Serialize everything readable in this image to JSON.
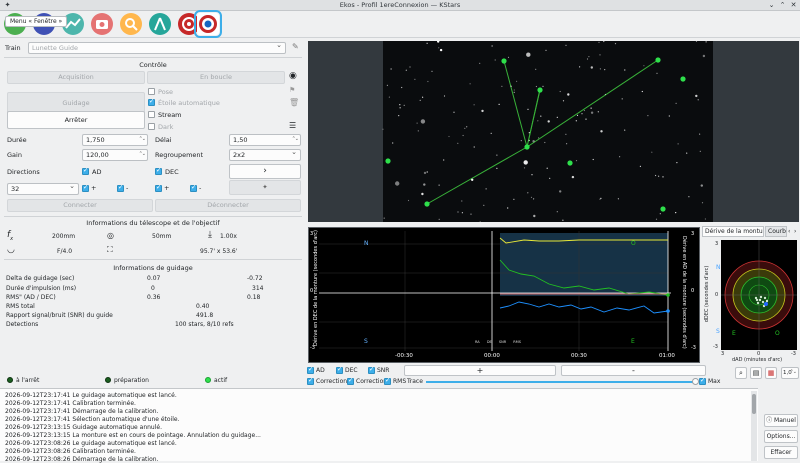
{
  "window": {
    "title": "Ekos - Profil 1ereConnexion — KStars"
  },
  "menu_button": "Menu « Fenêtre »",
  "train": {
    "label": "Train",
    "value": "Lunette Guide"
  },
  "controle": {
    "title": "Contrôle",
    "buttons": {
      "acquisition": "Acquisition",
      "en_boucle": "En boucle",
      "guidage": "Guidage",
      "arreter": "Arrêter",
      "connecter": "Connecter",
      "deconnecter": "Déconnecter"
    },
    "options": {
      "pose": "Pose",
      "etoile_auto": "Étoile automatique",
      "stream": "Stream",
      "dark": "Dark"
    },
    "duree": {
      "label": "Durée",
      "value": "1,750"
    },
    "delai": {
      "label": "Délai",
      "value": "1,50"
    },
    "gain": {
      "label": "Gain",
      "value": "120,00"
    },
    "regroupement": {
      "label": "Regroupement",
      "value": "2x2"
    },
    "directions": {
      "label": "Directions",
      "ad": "AD",
      "dec": "DEC"
    },
    "bin_value": "32",
    "plus": "+",
    "minus": "-"
  },
  "telescope": {
    "title": "Informations du télescope et de l'objectif",
    "focal1": "200mm",
    "focal2": "50mm",
    "ratio_val": "1.00x",
    "fnumber": "F/4.0",
    "fov": "95.7' x 53.6'"
  },
  "guidage_info": {
    "title": "Informations de guidage",
    "rows": [
      {
        "label": "Delta de guidage (sec)",
        "v1": "0.07",
        "v2": "-0.72"
      },
      {
        "label": "Durée d'impulsion (ms)",
        "v1": "0",
        "v2": "314"
      },
      {
        "label": "RMS\" (AD / DEC)",
        "v1": "0.36",
        "v2": "0.18"
      },
      {
        "label": "RMS total",
        "v1": "0.40",
        "v2": ""
      },
      {
        "label": "Rapport signal/bruit (SNR) du guide",
        "v1": "491.8",
        "v2": ""
      },
      {
        "label": "Detections",
        "v1": "100 stars, 8/10 refs",
        "v2": ""
      }
    ]
  },
  "status": {
    "arret": "à l'arrêt",
    "preparation": "préparation",
    "actif": "actif"
  },
  "graph": {
    "y_left": "Dérive en DEC de la monture (secondes d'arc)",
    "y_right": "Dérive en AD de la monture (secondes d'arc)",
    "x_ticks": [
      "-00:30",
      "00:00",
      "00:30",
      "01:00"
    ],
    "y_ticks": [
      "3",
      "2",
      "1",
      "0",
      "-1",
      "-2",
      "-3"
    ],
    "legend": [
      "RA",
      "DE",
      "SNR",
      "RMS"
    ],
    "n": "N",
    "s": "S",
    "o": "O",
    "e": "E",
    "controls": {
      "ad": "AD",
      "dec": "DEC",
      "snr": "SNR",
      "correction": "Correction",
      "rms": "RMS",
      "trace": "Trace",
      "max": "Max",
      "plus": "+",
      "minus": "-",
      "scale": "1,0"
    }
  },
  "drift": {
    "tabs": [
      "Dérive de la monture",
      "Courb"
    ],
    "ylabel": "dDEC (secondes d'arc)",
    "xlabel": "dAD (minutes d'arc)",
    "ticks": [
      "3",
      "2",
      "1",
      "0",
      "-1",
      "-2",
      "-3"
    ],
    "n": "N",
    "s": "S",
    "e": "E",
    "o": "O"
  },
  "log": {
    "lines": [
      "2026-09-12T23:17:41 Le guidage automatique est lancé.",
      "2026-09-12T23:17:41 Calibration terminée.",
      "2026-09-12T23:17:41 Démarrage de la calibration.",
      "2026-09-12T23:17:41 Sélection automatique d'une étoile.",
      "2026-09-12T23:13:15 Guidage automatique annulé.",
      "2026-09-12T23:13:15 La monture est en cours de pointage. Annulation du guidage...",
      "2026-09-12T23:08:26 Le guidage automatique est lancé.",
      "2026-09-12T23:08:26 Calibration terminée.",
      "2026-09-12T23:08:26 Démarrage de la calibration."
    ],
    "manuel": "Manuel",
    "options": "Options...",
    "effacer": "Effacer"
  },
  "colors": {
    "accent": "#3daee9",
    "ra": "#1e90ff",
    "dec": "#22c022",
    "snr": "#e8e838",
    "rms": "#ffffff"
  }
}
